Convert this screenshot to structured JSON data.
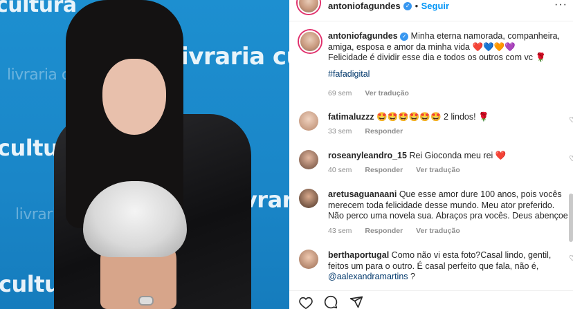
{
  "photo": {
    "watermarks": [
      "cultura",
      "livraria cultura",
      "livraria cu",
      "cultura",
      "livraria cu",
      "livraria cu",
      "cultura"
    ]
  },
  "header": {
    "username": "antoniofagundes",
    "follow_label": "Seguir",
    "more_label": "···"
  },
  "caption": {
    "username": "antoniofagundes",
    "text_line1": " Minha eterna namorada, companheira,",
    "text_line2": "amiga, esposa e amor da minha vida ❤️💙🧡💜",
    "text_line3": "Felicidade é dividir esse dia e todos os outros com vc 🌹",
    "hashtag": "#fafadigital",
    "time": "69 sem",
    "translate": "Ver tradução"
  },
  "comments": [
    {
      "username": "fatimaluzzz",
      "text": "🤩🤩🤩🤩🤩🤩 2 lindos! 🌹",
      "time": "33 sem",
      "reply": "Responder",
      "translate": ""
    },
    {
      "username": "roseanyleandro_15",
      "text": "Rei Gioconda meu rei ❤️",
      "time": "40 sem",
      "reply": "Responder",
      "translate": "Ver tradução"
    },
    {
      "username": "aretusaguanaani",
      "text_line1": " Que esse amor dure 100 anos, pois vocês",
      "text_line2": "merecem toda felicidade desse mundo. Meu ator preferido.",
      "text_line3": "Não perco uma novela sua. Abraços pra vocês. Deus abençoe",
      "time": "43 sem",
      "reply": "Responder",
      "translate": "Ver tradução"
    },
    {
      "username": "berthaportugal",
      "text_line1": " Como não vi esta foto?Casal lindo, gentil,",
      "text_line2": "feitos um para o outro. É casal perfeito que fala, não é,",
      "mention": "@aalexandramartins",
      "text_line3_suffix": " ?"
    }
  ],
  "actions": {
    "like_icon": "heart-outline-icon",
    "comment_icon": "comment-bubble-icon",
    "share_icon": "paper-plane-icon"
  },
  "colors": {
    "accent": "#0095f6",
    "verified": "#3897f0",
    "muted": "#8e8e8e",
    "photo_bg": "#1a86c8"
  }
}
